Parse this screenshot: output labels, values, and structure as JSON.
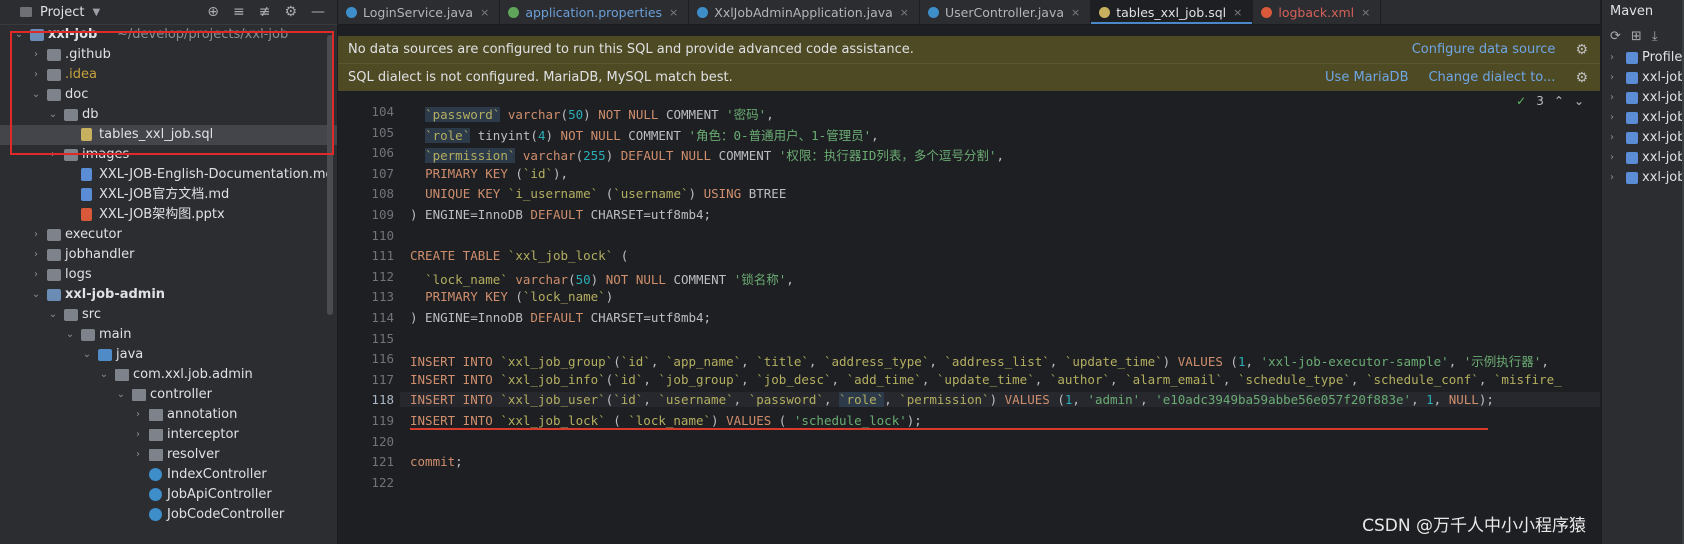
{
  "project_panel": {
    "title": "Project",
    "tree": [
      {
        "label": "xxl-job",
        "suffix": "~/develop/projects/xxl-job",
        "depth": 0,
        "arrow": "down",
        "icon": "folder-mod",
        "bold": true
      },
      {
        "label": ".github",
        "depth": 1,
        "arrow": "right",
        "icon": "folder"
      },
      {
        "label": ".idea",
        "depth": 1,
        "arrow": "right",
        "icon": "folder",
        "style": "idea"
      },
      {
        "label": "doc",
        "depth": 1,
        "arrow": "down",
        "icon": "folder"
      },
      {
        "label": "db",
        "depth": 2,
        "arrow": "down",
        "icon": "folder"
      },
      {
        "label": "tables_xxl_job.sql",
        "depth": 3,
        "icon": "file-sql",
        "selected": true
      },
      {
        "label": "images",
        "depth": 2,
        "arrow": "right",
        "icon": "folder"
      },
      {
        "label": "XXL-JOB-English-Documentation.md",
        "depth": 3,
        "icon": "file-md"
      },
      {
        "label": "XXL-JOB官方文档.md",
        "depth": 3,
        "icon": "file-md"
      },
      {
        "label": "XXL-JOB架构图.pptx",
        "depth": 3,
        "icon": "file-ppt"
      },
      {
        "label": "executor",
        "depth": 1,
        "arrow": "right",
        "icon": "folder"
      },
      {
        "label": "jobhandler",
        "depth": 1,
        "arrow": "right",
        "icon": "folder"
      },
      {
        "label": "logs",
        "depth": 1,
        "arrow": "right",
        "icon": "folder"
      },
      {
        "label": "xxl-job-admin",
        "depth": 1,
        "arrow": "down",
        "icon": "folder-mod",
        "bold": true
      },
      {
        "label": "src",
        "depth": 2,
        "arrow": "down",
        "icon": "folder"
      },
      {
        "label": "main",
        "depth": 3,
        "arrow": "down",
        "icon": "folder"
      },
      {
        "label": "java",
        "depth": 4,
        "arrow": "down",
        "icon": "folder-src"
      },
      {
        "label": "com.xxl.job.admin",
        "depth": 5,
        "arrow": "down",
        "icon": "pkg"
      },
      {
        "label": "controller",
        "depth": 6,
        "arrow": "down",
        "icon": "pkg"
      },
      {
        "label": "annotation",
        "depth": 7,
        "arrow": "right",
        "icon": "pkg"
      },
      {
        "label": "interceptor",
        "depth": 7,
        "arrow": "right",
        "icon": "pkg"
      },
      {
        "label": "resolver",
        "depth": 7,
        "arrow": "right",
        "icon": "pkg"
      },
      {
        "label": "IndexController",
        "depth": 7,
        "icon": "class"
      },
      {
        "label": "JobApiController",
        "depth": 7,
        "icon": "class"
      },
      {
        "label": "JobCodeController",
        "depth": 7,
        "icon": "class"
      }
    ]
  },
  "tabs": [
    {
      "label": "LoginService.java",
      "icon_color": "#3e8ec9"
    },
    {
      "label": "application.properties",
      "icon_color": "#5fa55a",
      "kind": "props"
    },
    {
      "label": "XxlJobAdminApplication.java",
      "icon_color": "#3e8ec9"
    },
    {
      "label": "UserController.java",
      "icon_color": "#3e8ec9"
    },
    {
      "label": "tables_xxl_job.sql",
      "icon_color": "#c8b15e",
      "active": true
    },
    {
      "label": "logback.xml",
      "icon_color": "#d9593a",
      "kind": "xml"
    }
  ],
  "banners": {
    "datasource": {
      "message": "No data sources are configured to run this SQL and provide advanced code assistance.",
      "action": "Configure data source"
    },
    "dialect": {
      "message": "SQL dialect is not configured. MariaDB, MySQL match best.",
      "action1": "Use MariaDB",
      "action2": "Change dialect to..."
    }
  },
  "inspection": {
    "count": "3"
  },
  "code_lines": [
    {
      "num": "104",
      "tokens": [
        [
          "p",
          "  "
        ],
        [
          "bt id",
          "`password`"
        ],
        [
          "p",
          " "
        ],
        [
          "k",
          "varchar"
        ],
        [
          "p",
          "("
        ],
        [
          "n",
          "50"
        ],
        [
          "p",
          ") "
        ],
        [
          "k",
          "NOT NULL "
        ],
        [
          "t",
          "COMMENT "
        ],
        [
          "s",
          "'密码'"
        ],
        [
          "p",
          ","
        ]
      ]
    },
    {
      "num": "105",
      "tokens": [
        [
          "p",
          "  "
        ],
        [
          "bt id",
          "`role`"
        ],
        [
          "p",
          " tinyint("
        ],
        [
          "n",
          "4"
        ],
        [
          "p",
          ") "
        ],
        [
          "k",
          "NOT NULL "
        ],
        [
          "t",
          "COMMENT "
        ],
        [
          "s",
          "'角色：0-普通用户、1-管理员'"
        ],
        [
          "p",
          ","
        ]
      ]
    },
    {
      "num": "106",
      "tokens": [
        [
          "p",
          "  "
        ],
        [
          "bt id",
          "`permission`"
        ],
        [
          "p",
          " "
        ],
        [
          "k",
          "varchar"
        ],
        [
          "p",
          "("
        ],
        [
          "n",
          "255"
        ],
        [
          "p",
          ") "
        ],
        [
          "k",
          "DEFAULT NULL "
        ],
        [
          "t",
          "COMMENT "
        ],
        [
          "s",
          "'权限：执行器ID列表，多个逗号分割'"
        ],
        [
          "p",
          ","
        ]
      ]
    },
    {
      "num": "107",
      "tokens": [
        [
          "p",
          "  "
        ],
        [
          "k",
          "PRIMARY KEY "
        ],
        [
          "p",
          "("
        ],
        [
          "id",
          "`id`"
        ],
        [
          "p",
          "),"
        ]
      ]
    },
    {
      "num": "108",
      "tokens": [
        [
          "p",
          "  "
        ],
        [
          "k",
          "UNIQUE KEY "
        ],
        [
          "id",
          "`i_username`"
        ],
        [
          "p",
          " ("
        ],
        [
          "id",
          "`username`"
        ],
        [
          "p",
          ") "
        ],
        [
          "k",
          "USING "
        ],
        [
          "t",
          "BTREE"
        ]
      ]
    },
    {
      "num": "109",
      "tokens": [
        [
          "p",
          ") ENGINE=InnoDB "
        ],
        [
          "k",
          "DEFAULT "
        ],
        [
          "t",
          "CHARSET=utf8mb4;"
        ]
      ]
    },
    {
      "num": "110",
      "tokens": []
    },
    {
      "num": "111",
      "tokens": [
        [
          "k",
          "CREATE TABLE "
        ],
        [
          "id",
          "`xxl_job_lock`"
        ],
        [
          "p",
          " ("
        ]
      ]
    },
    {
      "num": "112",
      "tokens": [
        [
          "p",
          "  "
        ],
        [
          "id",
          "`lock_name`"
        ],
        [
          "p",
          " "
        ],
        [
          "k",
          "varchar"
        ],
        [
          "p",
          "("
        ],
        [
          "n",
          "50"
        ],
        [
          "p",
          ") "
        ],
        [
          "k",
          "NOT NULL "
        ],
        [
          "t",
          "COMMENT "
        ],
        [
          "s",
          "'锁名称'"
        ],
        [
          "p",
          ","
        ]
      ]
    },
    {
      "num": "113",
      "tokens": [
        [
          "p",
          "  "
        ],
        [
          "k",
          "PRIMARY KEY "
        ],
        [
          "p",
          "("
        ],
        [
          "id",
          "`lock_name`"
        ],
        [
          "p",
          ")"
        ]
      ]
    },
    {
      "num": "114",
      "tokens": [
        [
          "p",
          ") ENGINE=InnoDB "
        ],
        [
          "k",
          "DEFAULT "
        ],
        [
          "t",
          "CHARSET=utf8mb4;"
        ]
      ]
    },
    {
      "num": "115",
      "tokens": []
    },
    {
      "num": "116",
      "tokens": [
        [
          "k",
          "INSERT INTO "
        ],
        [
          "id",
          "`xxl_job_group`"
        ],
        [
          "p",
          "("
        ],
        [
          "id",
          "`id`"
        ],
        [
          "p",
          ", "
        ],
        [
          "id",
          "`app_name`"
        ],
        [
          "p",
          ", "
        ],
        [
          "id",
          "`title`"
        ],
        [
          "p",
          ", "
        ],
        [
          "id",
          "`address_type`"
        ],
        [
          "p",
          ", "
        ],
        [
          "id",
          "`address_list`"
        ],
        [
          "p",
          ", "
        ],
        [
          "id",
          "`update_time`"
        ],
        [
          "p",
          ") "
        ],
        [
          "k",
          "VALUES "
        ],
        [
          "p",
          "("
        ],
        [
          "n",
          "1"
        ],
        [
          "p",
          ", "
        ],
        [
          "s",
          "'xxl-job-executor-sample'"
        ],
        [
          "p",
          ", "
        ],
        [
          "s",
          "'示例执行器'"
        ],
        [
          "p",
          ","
        ]
      ]
    },
    {
      "num": "117",
      "tokens": [
        [
          "k",
          "INSERT INTO "
        ],
        [
          "id",
          "`xxl_job_info`"
        ],
        [
          "p",
          "("
        ],
        [
          "id",
          "`id`"
        ],
        [
          "p",
          ", "
        ],
        [
          "id",
          "`job_group`"
        ],
        [
          "p",
          ", "
        ],
        [
          "id",
          "`job_desc`"
        ],
        [
          "p",
          ", "
        ],
        [
          "id",
          "`add_time`"
        ],
        [
          "p",
          ", "
        ],
        [
          "id",
          "`update_time`"
        ],
        [
          "p",
          ", "
        ],
        [
          "id",
          "`author`"
        ],
        [
          "p",
          ", "
        ],
        [
          "id",
          "`alarm_email`"
        ],
        [
          "p",
          ", "
        ],
        [
          "id",
          "`schedule_type`"
        ],
        [
          "p",
          ", "
        ],
        [
          "id",
          "`schedule_conf`"
        ],
        [
          "p",
          ", "
        ],
        [
          "id",
          "`misfire_"
        ]
      ]
    },
    {
      "num": "118",
      "current": true,
      "tokens": [
        [
          "k",
          "INSERT INTO "
        ],
        [
          "id",
          "`xxl_job_user`"
        ],
        [
          "p",
          "("
        ],
        [
          "id",
          "`id`"
        ],
        [
          "p",
          ", "
        ],
        [
          "id",
          "`username`"
        ],
        [
          "p",
          ", "
        ],
        [
          "id",
          "`password`"
        ],
        [
          "p",
          ", "
        ],
        [
          "bt id",
          "`role`"
        ],
        [
          "p",
          ", "
        ],
        [
          "id",
          "`permission`"
        ],
        [
          "p",
          ") "
        ],
        [
          "k",
          "VALUES "
        ],
        [
          "p",
          "("
        ],
        [
          "n",
          "1"
        ],
        [
          "p",
          ", "
        ],
        [
          "s",
          "'admin'"
        ],
        [
          "p",
          ", "
        ],
        [
          "s",
          "'e10adc3949ba59abbe56e057f20f883e'"
        ],
        [
          "p",
          ", "
        ],
        [
          "n",
          "1"
        ],
        [
          "p",
          ", "
        ],
        [
          "k",
          "NULL"
        ],
        [
          "p",
          ");"
        ]
      ]
    },
    {
      "num": "119",
      "tokens": [
        [
          "k",
          "INSERT INTO "
        ],
        [
          "id",
          "`xxl_job_lock`"
        ],
        [
          "p",
          " ( "
        ],
        [
          "id",
          "`lock_name`"
        ],
        [
          "p",
          ") "
        ],
        [
          "k",
          "VALUES "
        ],
        [
          "p",
          "( "
        ],
        [
          "s",
          "'schedule_lock'"
        ],
        [
          "p",
          ");"
        ]
      ]
    },
    {
      "num": "120",
      "tokens": []
    },
    {
      "num": "121",
      "tokens": [
        [
          "k",
          "commit"
        ],
        [
          "p",
          ";"
        ]
      ]
    },
    {
      "num": "122",
      "tokens": []
    }
  ],
  "maven": {
    "title": "Maven",
    "items": [
      "Profiles",
      "xxl-job",
      "xxl-job",
      "xxl-job",
      "xxl-job",
      "xxl-job",
      "xxl-job"
    ]
  },
  "watermark": "CSDN @万千人中小小程序猿"
}
